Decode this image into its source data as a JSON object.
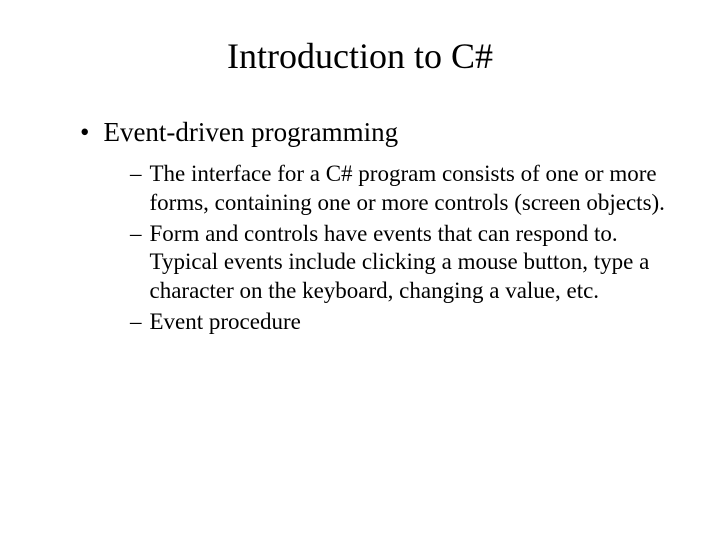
{
  "title": "Introduction to C#",
  "bullets": {
    "level1": {
      "item0": "Event-driven programming"
    },
    "level2": {
      "item0": "The interface for a C# program consists of one or more forms, containing one or more controls (screen objects).",
      "item1": "Form and controls have events that can respond to.  Typical events include clicking a mouse button, type a character on the keyboard, changing a value, etc.",
      "item2": "Event procedure"
    }
  }
}
